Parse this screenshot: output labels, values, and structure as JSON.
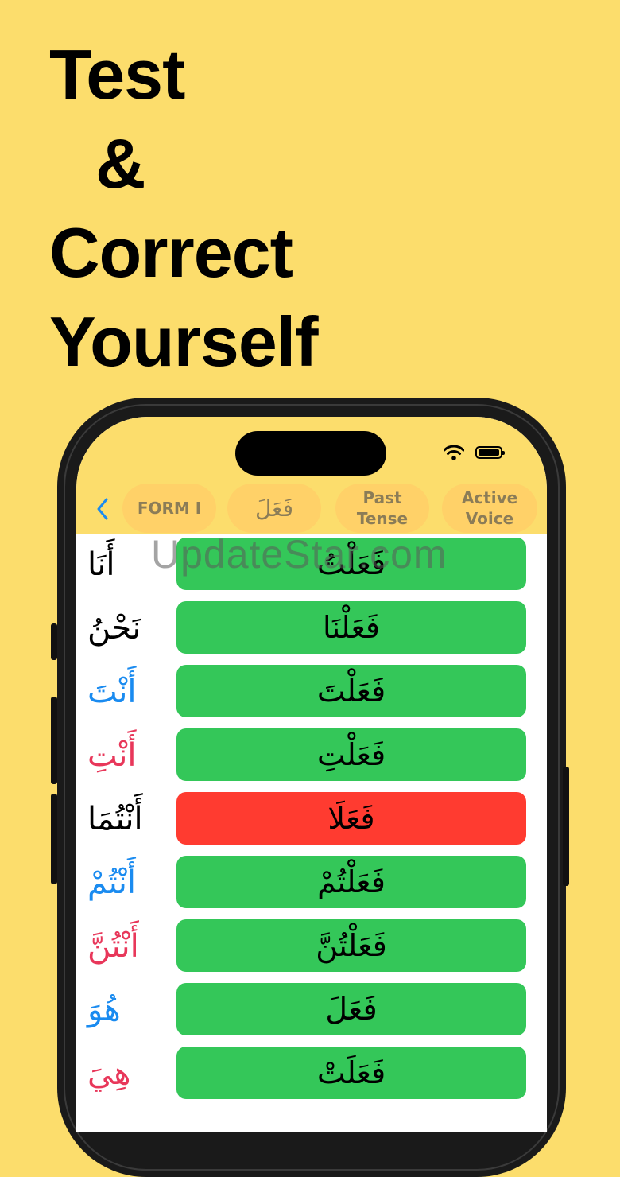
{
  "headline": [
    "Test",
    "&",
    "Correct",
    "Yourself"
  ],
  "toolbar": {
    "back_icon": "chevron-left-icon",
    "chips": [
      "FORM I",
      "فَعَلَ",
      "Past Tense",
      "Active Voice"
    ]
  },
  "status": {
    "wifi_icon": "wifi-icon",
    "battery_icon": "battery-icon"
  },
  "colors": {
    "background": "#FCDD6C",
    "correct": "#34C759",
    "wrong": "#FF3B30",
    "neutral": "#000000",
    "masculine": "#1A8BF0",
    "feminine": "#E8375A"
  },
  "rows": [
    {
      "pronoun": "أَنَا",
      "answer": "فَعَلْتُ",
      "status": "correct",
      "gender": "neutral"
    },
    {
      "pronoun": "نَحْنُ",
      "answer": "فَعَلْنَا",
      "status": "correct",
      "gender": "neutral"
    },
    {
      "pronoun": "أَنْتَ",
      "answer": "فَعَلْتَ",
      "status": "correct",
      "gender": "masculine"
    },
    {
      "pronoun": "أَنْتِ",
      "answer": "فَعَلْتِ",
      "status": "correct",
      "gender": "feminine"
    },
    {
      "pronoun": "أَنْتُمَا",
      "answer": "فَعَلَا",
      "status": "wrong",
      "gender": "neutral"
    },
    {
      "pronoun": "أَنْتُمْ",
      "answer": "فَعَلْتُمْ",
      "status": "correct",
      "gender": "masculine"
    },
    {
      "pronoun": "أَنْتُنَّ",
      "answer": "فَعَلْتُنَّ",
      "status": "correct",
      "gender": "feminine"
    },
    {
      "pronoun": "هُوَ",
      "answer": "فَعَلَ",
      "status": "correct",
      "gender": "masculine"
    },
    {
      "pronoun": "هِيَ",
      "answer": "فَعَلَتْ",
      "status": "correct",
      "gender": "feminine"
    }
  ],
  "watermark": "UpdateStar.com"
}
